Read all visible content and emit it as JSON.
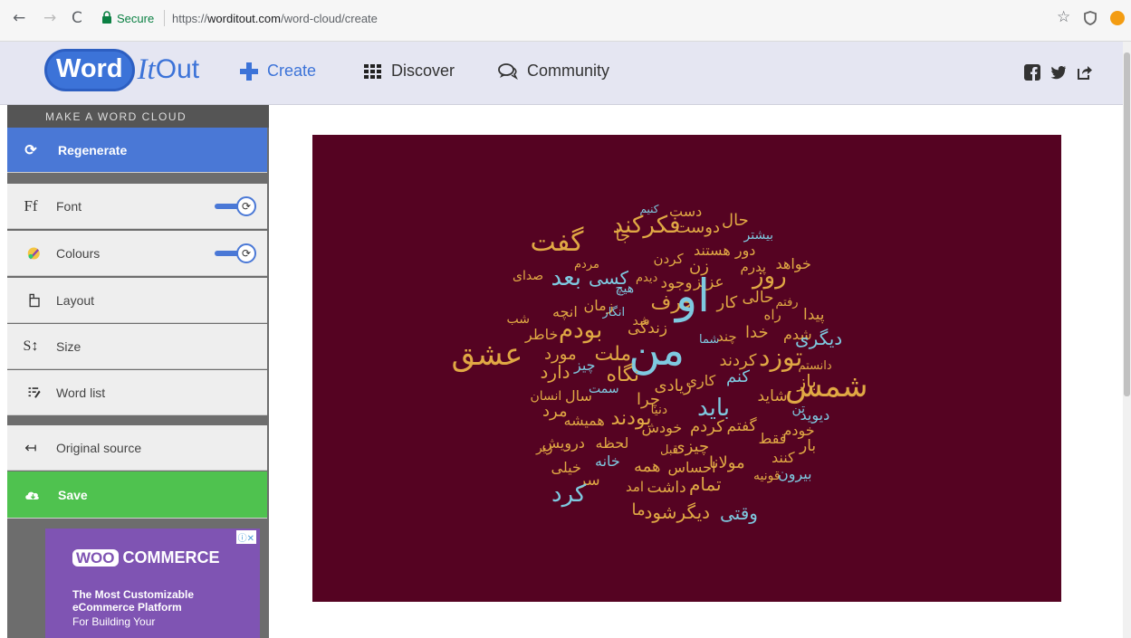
{
  "browser": {
    "secure_label": "Secure",
    "url_scheme": "https://",
    "url_host": "worditout.com",
    "url_path": "/word-cloud/create"
  },
  "header": {
    "logo_word": "Word",
    "logo_it": "It",
    "logo_out": "Out",
    "nav": {
      "create": "Create",
      "discover": "Discover",
      "community": "Community"
    }
  },
  "sidebar": {
    "title": "MAKE A WORD CLOUD",
    "regenerate": "Regenerate",
    "font": "Font",
    "font_icon_text": "Ff",
    "colours": "Colours",
    "layout": "Layout",
    "size": "Size",
    "size_icon_text": "S",
    "word_list": "Word list",
    "original_source": "Original source",
    "save": "Save"
  },
  "ad": {
    "logo_woo": "WOO",
    "logo_commerce": "COMMERCE",
    "headline": "The Most Customizable eCommerce Platform",
    "sub": "For Building Your"
  },
  "colors": {
    "canvas_bg": "#550322",
    "word_gold": "#e0a844",
    "word_blue": "#7ec9e0",
    "accent": "#3c73d8",
    "save_green": "#4fc24f"
  },
  "word_cloud": {
    "words": [
      {
        "t": "دست",
        "c": "gold"
      },
      {
        "t": "کنیم",
        "c": "blue"
      },
      {
        "t": "حال",
        "c": "gold"
      },
      {
        "t": "دوست",
        "c": "gold"
      },
      {
        "t": "فکرکند",
        "c": "gold"
      },
      {
        "t": "جا",
        "c": "gold"
      },
      {
        "t": "بیشتر",
        "c": "blue"
      },
      {
        "t": "گفت",
        "c": "gold"
      },
      {
        "t": "دور هستند",
        "c": "gold"
      },
      {
        "t": "کردن",
        "c": "gold"
      },
      {
        "t": "مردم",
        "c": "gold"
      },
      {
        "t": "خواهد",
        "c": "gold"
      },
      {
        "t": "پدرم",
        "c": "gold"
      },
      {
        "t": "زن",
        "c": "gold"
      },
      {
        "t": "روز",
        "c": "gold"
      },
      {
        "t": "صدای",
        "c": "gold"
      },
      {
        "t": "بعد",
        "c": "blue"
      },
      {
        "t": "کسی",
        "c": "blue"
      },
      {
        "t": "دیدم",
        "c": "gold"
      },
      {
        "t": "وجود",
        "c": "gold"
      },
      {
        "t": "عزیز",
        "c": "gold"
      },
      {
        "t": "هیچ",
        "c": "blue"
      },
      {
        "t": "حالی",
        "c": "gold"
      },
      {
        "t": "رفتم",
        "c": "gold"
      },
      {
        "t": "کار",
        "c": "gold"
      },
      {
        "t": "حرف",
        "c": "gold"
      },
      {
        "t": "زمان",
        "c": "gold"
      },
      {
        "t": "انگار",
        "c": "blue"
      },
      {
        "t": "او",
        "c": "blue"
      },
      {
        "t": "راه",
        "c": "gold"
      },
      {
        "t": "پیدا",
        "c": "gold"
      },
      {
        "t": "انچه",
        "c": "gold"
      },
      {
        "t": "شب",
        "c": "gold"
      },
      {
        "t": "شد",
        "c": "gold"
      },
      {
        "t": "زندگی",
        "c": "gold"
      },
      {
        "t": "خاطر",
        "c": "gold"
      },
      {
        "t": "بودم",
        "c": "gold"
      },
      {
        "t": "شما",
        "c": "blue"
      },
      {
        "t": "چند",
        "c": "gold"
      },
      {
        "t": "خدا",
        "c": "gold"
      },
      {
        "t": "شدم",
        "c": "gold"
      },
      {
        "t": "دیگری",
        "c": "blue"
      },
      {
        "t": "عشق",
        "c": "gold"
      },
      {
        "t": "مورد",
        "c": "gold"
      },
      {
        "t": "ملت",
        "c": "gold"
      },
      {
        "t": "من",
        "c": "blue"
      },
      {
        "t": "کردند",
        "c": "gold"
      },
      {
        "t": "توزد",
        "c": "gold"
      },
      {
        "t": "دانستم",
        "c": "gold"
      },
      {
        "t": "چیز",
        "c": "blue"
      },
      {
        "t": "دارد",
        "c": "gold"
      },
      {
        "t": "نگاه",
        "c": "gold"
      },
      {
        "t": "کنم",
        "c": "blue"
      },
      {
        "t": "کاری",
        "c": "gold"
      },
      {
        "t": "زیادی",
        "c": "gold"
      },
      {
        "t": "باز",
        "c": "gold"
      },
      {
        "t": "شمس",
        "c": "gold"
      },
      {
        "t": "سمت",
        "c": "blue"
      },
      {
        "t": "سال",
        "c": "gold"
      },
      {
        "t": "انسان",
        "c": "gold"
      },
      {
        "t": "چرا",
        "c": "gold"
      },
      {
        "t": "شاید",
        "c": "gold"
      },
      {
        "t": "باید",
        "c": "blue"
      },
      {
        "t": "دنیا",
        "c": "gold"
      },
      {
        "t": "تن",
        "c": "blue"
      },
      {
        "t": "مرد",
        "c": "gold"
      },
      {
        "t": "همیشه",
        "c": "gold"
      },
      {
        "t": "بودند",
        "c": "gold"
      },
      {
        "t": "دیوید",
        "c": "blue"
      },
      {
        "t": "خودش",
        "c": "gold"
      },
      {
        "t": "کردم",
        "c": "gold"
      },
      {
        "t": "گفتم",
        "c": "gold"
      },
      {
        "t": "خودم",
        "c": "gold"
      },
      {
        "t": "فقط",
        "c": "gold"
      },
      {
        "t": "درویش",
        "c": "gold"
      },
      {
        "t": "زیر",
        "c": "gold"
      },
      {
        "t": "لحظه",
        "c": "gold"
      },
      {
        "t": "قبل",
        "c": "gold"
      },
      {
        "t": "چیزی",
        "c": "gold"
      },
      {
        "t": "بار",
        "c": "gold"
      },
      {
        "t": "کنند",
        "c": "gold"
      },
      {
        "t": "خانه",
        "c": "blue"
      },
      {
        "t": "همه",
        "c": "gold"
      },
      {
        "t": "احساس",
        "c": "gold"
      },
      {
        "t": "مولانا",
        "c": "gold"
      },
      {
        "t": "خیلی",
        "c": "gold"
      },
      {
        "t": "سر",
        "c": "gold"
      },
      {
        "t": "قونیه",
        "c": "gold"
      },
      {
        "t": "بیرون",
        "c": "blue"
      },
      {
        "t": "کرد",
        "c": "blue"
      },
      {
        "t": "امد",
        "c": "gold"
      },
      {
        "t": "داشت",
        "c": "gold"
      },
      {
        "t": "تمام",
        "c": "gold"
      },
      {
        "t": "ما",
        "c": "gold"
      },
      {
        "t": "دیگرشود",
        "c": "gold"
      },
      {
        "t": "وقتی",
        "c": "blue"
      }
    ]
  }
}
